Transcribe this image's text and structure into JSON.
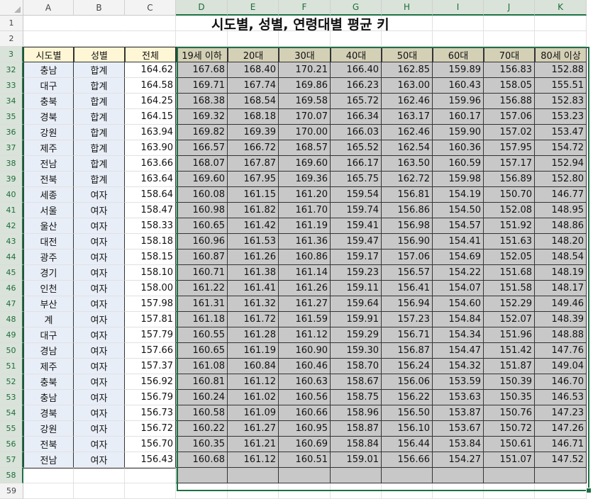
{
  "sheet_title": "시도별, 성별, 연령대별 평균 키",
  "columns": [
    "A",
    "B",
    "C",
    "D",
    "E",
    "F",
    "G",
    "H",
    "I",
    "J",
    "K"
  ],
  "header_row": [
    "시도별",
    "성별",
    "전체",
    "19세 이하",
    "20대",
    "30대",
    "40대",
    "50대",
    "60대",
    "70대",
    "80세 이상"
  ],
  "top_rows": [
    "1",
    "2",
    "3"
  ],
  "rows": [
    {
      "n": "32",
      "a": "충남",
      "b": "합계",
      "v": [
        "164.62",
        "167.68",
        "168.40",
        "170.21",
        "166.40",
        "162.85",
        "159.89",
        "156.83",
        "152.88"
      ]
    },
    {
      "n": "33",
      "a": "대구",
      "b": "합계",
      "v": [
        "164.58",
        "169.71",
        "167.74",
        "169.86",
        "166.23",
        "163.00",
        "160.43",
        "158.05",
        "155.51"
      ]
    },
    {
      "n": "34",
      "a": "충북",
      "b": "합계",
      "v": [
        "164.25",
        "168.38",
        "168.54",
        "169.58",
        "165.72",
        "162.46",
        "159.96",
        "156.88",
        "152.83"
      ]
    },
    {
      "n": "35",
      "a": "경북",
      "b": "합계",
      "v": [
        "164.15",
        "169.32",
        "168.18",
        "170.07",
        "166.34",
        "163.17",
        "160.17",
        "157.06",
        "153.23"
      ]
    },
    {
      "n": "36",
      "a": "강원",
      "b": "합계",
      "v": [
        "163.94",
        "169.82",
        "169.39",
        "170.00",
        "166.03",
        "162.46",
        "159.90",
        "157.02",
        "153.47"
      ]
    },
    {
      "n": "37",
      "a": "제주",
      "b": "합계",
      "v": [
        "163.90",
        "166.57",
        "166.72",
        "168.57",
        "165.52",
        "162.54",
        "160.36",
        "157.95",
        "154.72"
      ]
    },
    {
      "n": "38",
      "a": "전남",
      "b": "합계",
      "v": [
        "163.66",
        "168.07",
        "167.87",
        "169.60",
        "166.17",
        "163.50",
        "160.59",
        "157.17",
        "152.94"
      ]
    },
    {
      "n": "39",
      "a": "전북",
      "b": "합계",
      "v": [
        "163.64",
        "169.60",
        "167.95",
        "169.36",
        "165.75",
        "162.72",
        "159.98",
        "156.89",
        "152.80"
      ]
    },
    {
      "n": "40",
      "a": "세종",
      "b": "여자",
      "v": [
        "158.64",
        "160.08",
        "161.15",
        "161.20",
        "159.54",
        "156.81",
        "154.19",
        "150.70",
        "146.77"
      ]
    },
    {
      "n": "41",
      "a": "서울",
      "b": "여자",
      "v": [
        "158.47",
        "160.98",
        "161.82",
        "161.70",
        "159.74",
        "156.86",
        "154.50",
        "152.08",
        "148.95"
      ]
    },
    {
      "n": "42",
      "a": "울산",
      "b": "여자",
      "v": [
        "158.33",
        "160.65",
        "161.42",
        "161.19",
        "159.41",
        "156.98",
        "154.57",
        "151.92",
        "148.86"
      ]
    },
    {
      "n": "43",
      "a": "대전",
      "b": "여자",
      "v": [
        "158.18",
        "160.96",
        "161.53",
        "161.36",
        "159.47",
        "156.90",
        "154.41",
        "151.63",
        "148.20"
      ]
    },
    {
      "n": "44",
      "a": "광주",
      "b": "여자",
      "v": [
        "158.15",
        "160.87",
        "161.26",
        "160.86",
        "159.17",
        "157.06",
        "154.69",
        "152.05",
        "148.54"
      ]
    },
    {
      "n": "45",
      "a": "경기",
      "b": "여자",
      "v": [
        "158.10",
        "160.71",
        "161.38",
        "161.14",
        "159.23",
        "156.57",
        "154.22",
        "151.68",
        "148.19"
      ]
    },
    {
      "n": "46",
      "a": "인천",
      "b": "여자",
      "v": [
        "158.00",
        "161.22",
        "161.41",
        "161.26",
        "159.11",
        "156.41",
        "154.07",
        "151.58",
        "148.17"
      ]
    },
    {
      "n": "47",
      "a": "부산",
      "b": "여자",
      "v": [
        "157.98",
        "161.31",
        "161.32",
        "161.27",
        "159.64",
        "156.94",
        "154.60",
        "152.29",
        "149.46"
      ]
    },
    {
      "n": "48",
      "a": "계",
      "b": "여자",
      "v": [
        "157.81",
        "161.18",
        "161.72",
        "161.59",
        "159.91",
        "157.23",
        "154.84",
        "152.07",
        "148.39"
      ]
    },
    {
      "n": "49",
      "a": "대구",
      "b": "여자",
      "v": [
        "157.79",
        "160.55",
        "161.28",
        "161.12",
        "159.29",
        "156.71",
        "154.34",
        "151.96",
        "148.88"
      ]
    },
    {
      "n": "50",
      "a": "경남",
      "b": "여자",
      "v": [
        "157.66",
        "160.65",
        "161.19",
        "160.90",
        "159.30",
        "156.87",
        "154.47",
        "151.42",
        "147.76"
      ]
    },
    {
      "n": "51",
      "a": "제주",
      "b": "여자",
      "v": [
        "157.37",
        "161.08",
        "160.84",
        "160.46",
        "158.70",
        "156.24",
        "154.32",
        "151.87",
        "149.04"
      ]
    },
    {
      "n": "52",
      "a": "충북",
      "b": "여자",
      "v": [
        "156.92",
        "160.81",
        "161.12",
        "160.63",
        "158.67",
        "156.06",
        "153.59",
        "150.39",
        "146.70"
      ]
    },
    {
      "n": "53",
      "a": "충남",
      "b": "여자",
      "v": [
        "156.79",
        "160.24",
        "161.02",
        "160.56",
        "158.75",
        "156.22",
        "153.63",
        "150.35",
        "146.53"
      ]
    },
    {
      "n": "54",
      "a": "경북",
      "b": "여자",
      "v": [
        "156.73",
        "160.58",
        "161.09",
        "160.66",
        "158.96",
        "156.50",
        "153.87",
        "150.76",
        "147.23"
      ]
    },
    {
      "n": "55",
      "a": "강원",
      "b": "여자",
      "v": [
        "156.72",
        "160.22",
        "161.27",
        "160.95",
        "158.87",
        "156.10",
        "153.67",
        "150.72",
        "147.26"
      ]
    },
    {
      "n": "56",
      "a": "전북",
      "b": "여자",
      "v": [
        "156.70",
        "160.35",
        "161.21",
        "160.69",
        "158.84",
        "156.44",
        "153.84",
        "150.61",
        "146.71"
      ]
    },
    {
      "n": "57",
      "a": "전남",
      "b": "여자",
      "v": [
        "156.43",
        "160.68",
        "161.12",
        "160.51",
        "159.01",
        "156.66",
        "154.27",
        "151.07",
        "147.52"
      ]
    }
  ],
  "after_rows": [
    "58",
    "59"
  ]
}
